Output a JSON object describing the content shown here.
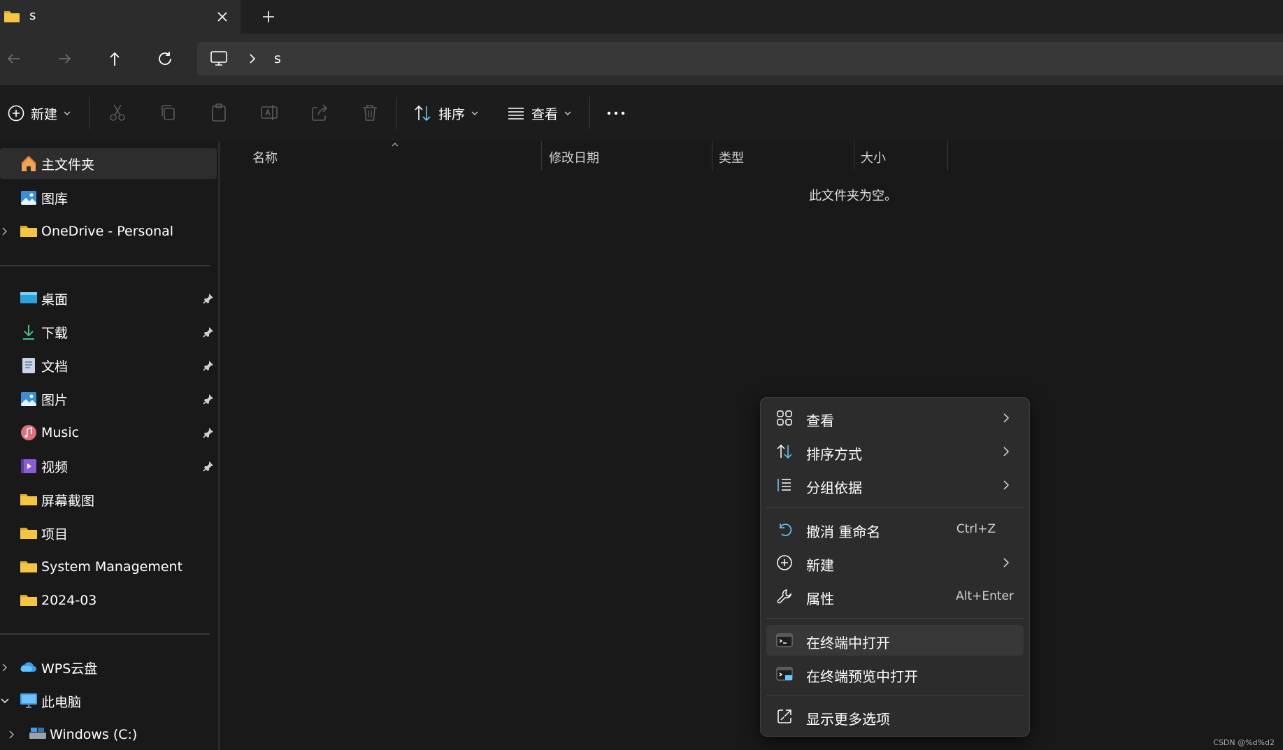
{
  "tab": {
    "title": "s"
  },
  "address": {
    "crumb": "s"
  },
  "toolbar": {
    "new_label": "新建",
    "sort_label": "排序",
    "view_label": "查看"
  },
  "sidebar": {
    "home": "主文件夹",
    "gallery": "图库",
    "onedrive": "OneDrive - Personal",
    "pinned": [
      "桌面",
      "下载",
      "文档",
      "图片",
      "Music",
      "视频"
    ],
    "folders": [
      "屏幕截图",
      "项目",
      "System Management",
      "2024-03"
    ],
    "wps": "WPS云盘",
    "thispc": "此电脑",
    "drive": "Windows (C:)"
  },
  "columns": {
    "name": "名称",
    "date": "修改日期",
    "type": "类型",
    "size": "大小"
  },
  "empty_message": "此文件夹为空。",
  "context_menu": {
    "view": "查看",
    "sort": "排序方式",
    "group": "分组依据",
    "undo": "撤消 重命名",
    "undo_shortcut": "Ctrl+Z",
    "new": "新建",
    "properties": "属性",
    "properties_shortcut": "Alt+Enter",
    "open_terminal": "在终端中打开",
    "open_terminal_preview": "在终端预览中打开",
    "more_options": "显示更多选项"
  },
  "watermark": "CSDN @%d%d2",
  "colors": {
    "accent": "#60cdff",
    "folder": "#f4c542",
    "background": "#191919",
    "menu": "#2c2c2c"
  }
}
